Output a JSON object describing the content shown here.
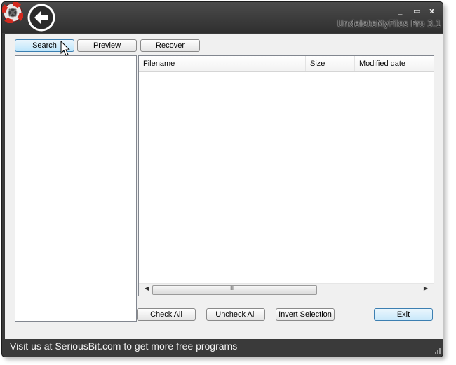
{
  "window": {
    "title": "UndeleteMyFiles Pro 3.1",
    "controls": {
      "minimize": "_",
      "maximize": "▭",
      "close": "x"
    }
  },
  "toolbar": {
    "search_label": "Search",
    "preview_label": "Preview",
    "recover_label": "Recover"
  },
  "file_list": {
    "columns": [
      "Filename",
      "Size",
      "Modified date"
    ],
    "rows": []
  },
  "scrollbar": {
    "grip": "III"
  },
  "actions": {
    "check_all_label": "Check All",
    "uncheck_all_label": "Uncheck All",
    "invert_selection_label": "Invert Selection",
    "exit_label": "Exit"
  },
  "status": {
    "text": "Visit us at SeriousBit.com to get more free programs"
  },
  "icons": [
    "lifebuoy-logo-icon",
    "back-arrow-icon",
    "scroll-left-icon",
    "scroll-right-icon",
    "size-grip-icon",
    "mouse-cursor-icon"
  ],
  "colors": {
    "frame": "#3a3a3a",
    "client": "#f0f0f0",
    "hover_button": "#bde5fb"
  }
}
